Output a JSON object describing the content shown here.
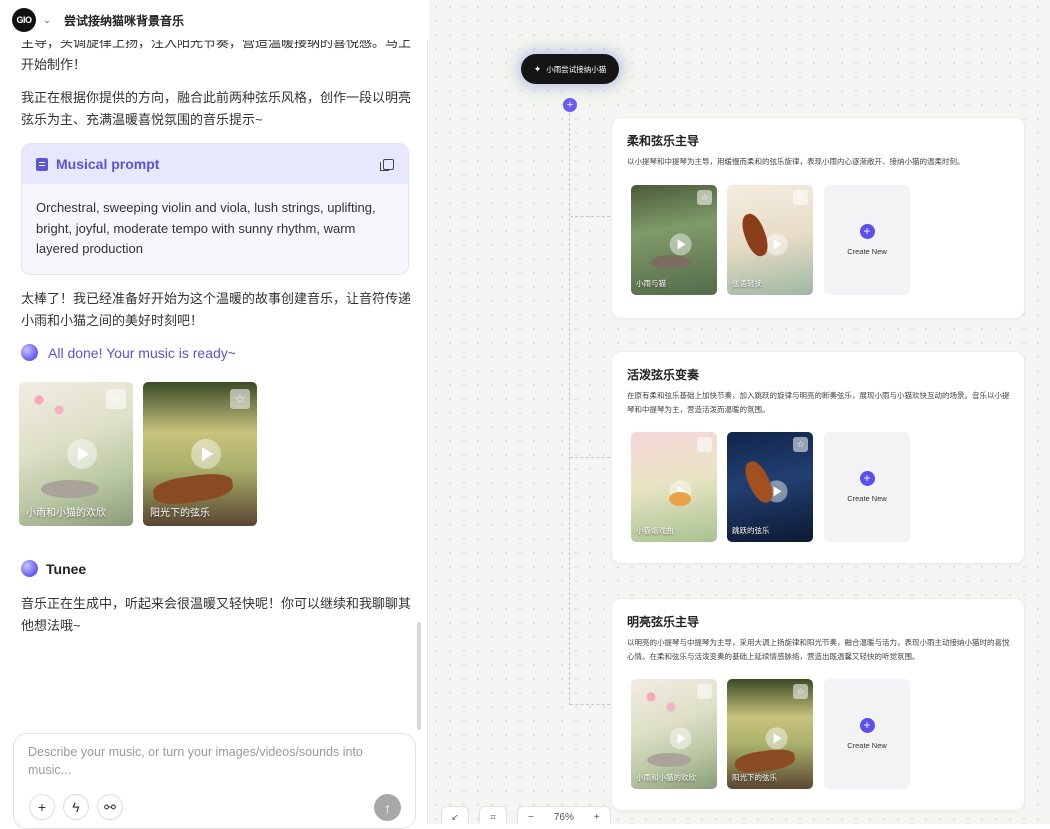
{
  "app": {
    "title": "尝试接纳猫咪背景音乐",
    "logo_text": "GIO"
  },
  "chat": {
    "para1": "主导，头调旋律上扬，注入阳光节奏，营造温暖接纳的喜悦感。马上开始制作！",
    "para2": "我正在根据你提供的方向，融合此前两种弦乐风格，创作一段以明亮弦乐为主、充满温暖喜悦氛围的音乐提示~",
    "prompt": {
      "title": "Musical prompt",
      "body": "Orchestral, sweeping violin and viola, lush strings, uplifting, bright, joyful, moderate tempo with sunny rhythm, warm layered production"
    },
    "para3": "太棒了！我已经准备好开始为这个温暖的故事创建音乐，让音符传递小雨和小猫之间的美好时刻吧！",
    "done_text": "All done! Your music is ready~",
    "tracks": [
      {
        "caption": "小雨和小猫的欢欣"
      },
      {
        "caption": "阳光下的弦乐"
      }
    ],
    "assistant_name": "Tunee",
    "para4": "音乐正在生成中，听起来会很温暖又轻快呢！你可以继续和我聊聊其他想法哦~"
  },
  "composer": {
    "placeholder": "Describe your music, or turn your images/videos/sounds into music..."
  },
  "canvas": {
    "root_label": "小雨尝试接纳小猫",
    "branches": [
      {
        "title": "柔和弦乐主导",
        "desc": "以小提琴和中提琴为主导，用缓慢而柔和的弦乐旋律，表现小雨内心逐渐敞开、接纳小猫的温柔时刻。",
        "tracks": [
          {
            "caption": "小雨与猫"
          },
          {
            "caption": "弦语轻抚"
          }
        ],
        "create_label": "Create New"
      },
      {
        "title": "活泼弦乐变奏",
        "desc": "在原有柔和弦乐基础上加快节奏，加入跳跃的旋律与明亮的断奏弦乐，展现小雨与小猫欢快互动的场景。音乐以小提琴和中提琴为主，营造活泼而温暖的氛围。",
        "tracks": [
          {
            "caption": "小猫嬉戏曲"
          },
          {
            "caption": "跳跃的弦乐"
          }
        ],
        "create_label": "Create New"
      },
      {
        "title": "明亮弦乐主导",
        "desc": "以明亮的小提琴与中提琴为主导，采用大调上扬旋律和阳光节奏，融合温暖与活力，表现小雨主动接纳小猫时的喜悦心情。在柔和弦乐与活泼变奏的基础上延续情感脉络，营造出既温馨又轻快的听觉氛围。",
        "tracks": [
          {
            "caption": "小雨和小猫的欢欣"
          },
          {
            "caption": "阳光下的弦乐"
          }
        ],
        "create_label": "Create New"
      }
    ],
    "zoom_level": "76%"
  }
}
